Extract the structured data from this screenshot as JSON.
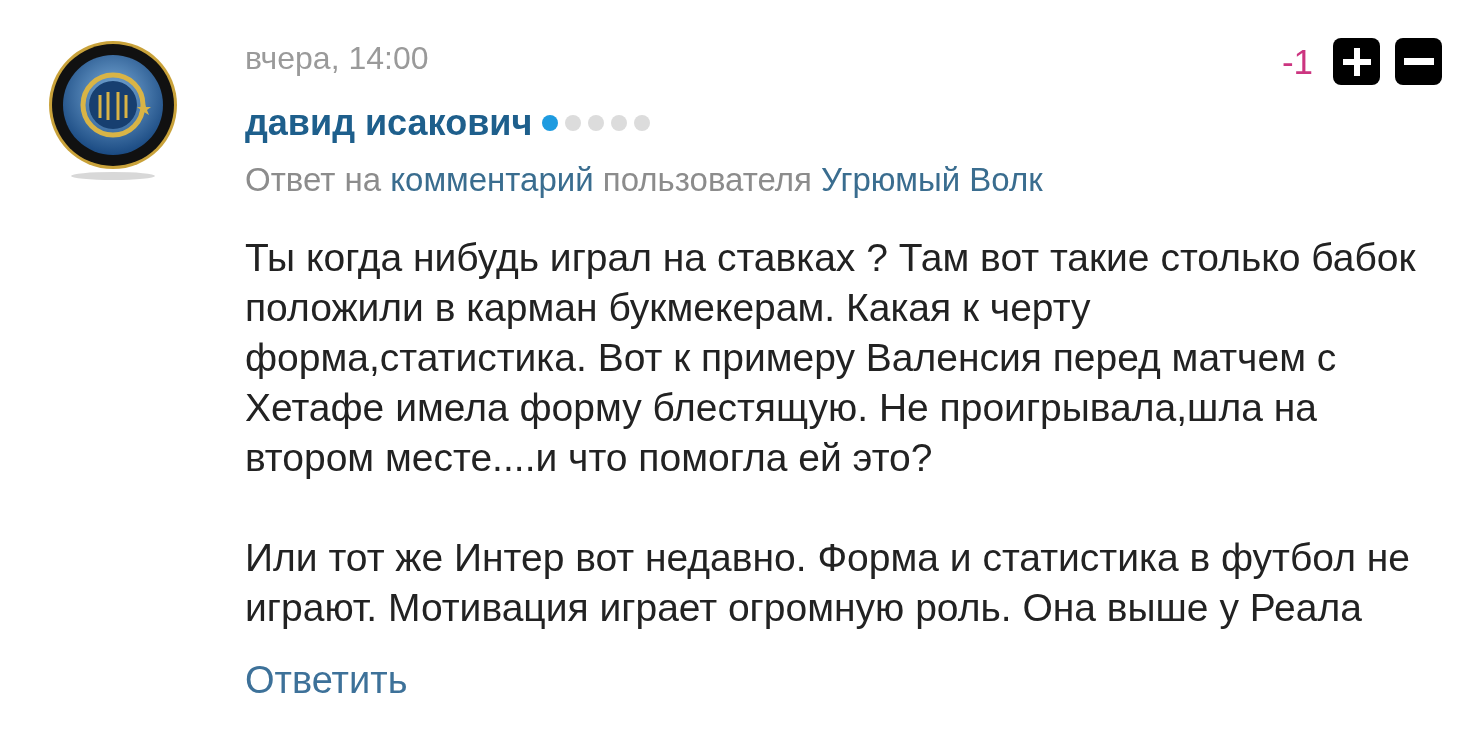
{
  "comment": {
    "timestamp": "вчера, 14:00",
    "score": "-1",
    "author": {
      "name": "давид исакович",
      "stars": 1
    },
    "reply_context": [
      {
        "kind": "text",
        "text": "Ответ на"
      },
      {
        "kind": "link",
        "text": "комментарий"
      },
      {
        "kind": "text",
        "text": "пользователя"
      },
      {
        "kind": "link",
        "text": "Угрюмый Волк"
      }
    ],
    "body": [
      "Ты когда нибудь играл на ставках ? Там вот такие столько бабок положили в карман букмекерам. Какая к черту форма,статистика. Вот к примеру Валенсия перед матчем с Хетафе имела форму блестящую. Не проигрывала,шла на втором месте....и что помогла ей это?",
      "Или тот же Интер вот недавно. Форма и статистика в футбол не играют. Мотивация играет огромную роль. Она выше у Реала"
    ],
    "reply_link": "Ответить"
  }
}
